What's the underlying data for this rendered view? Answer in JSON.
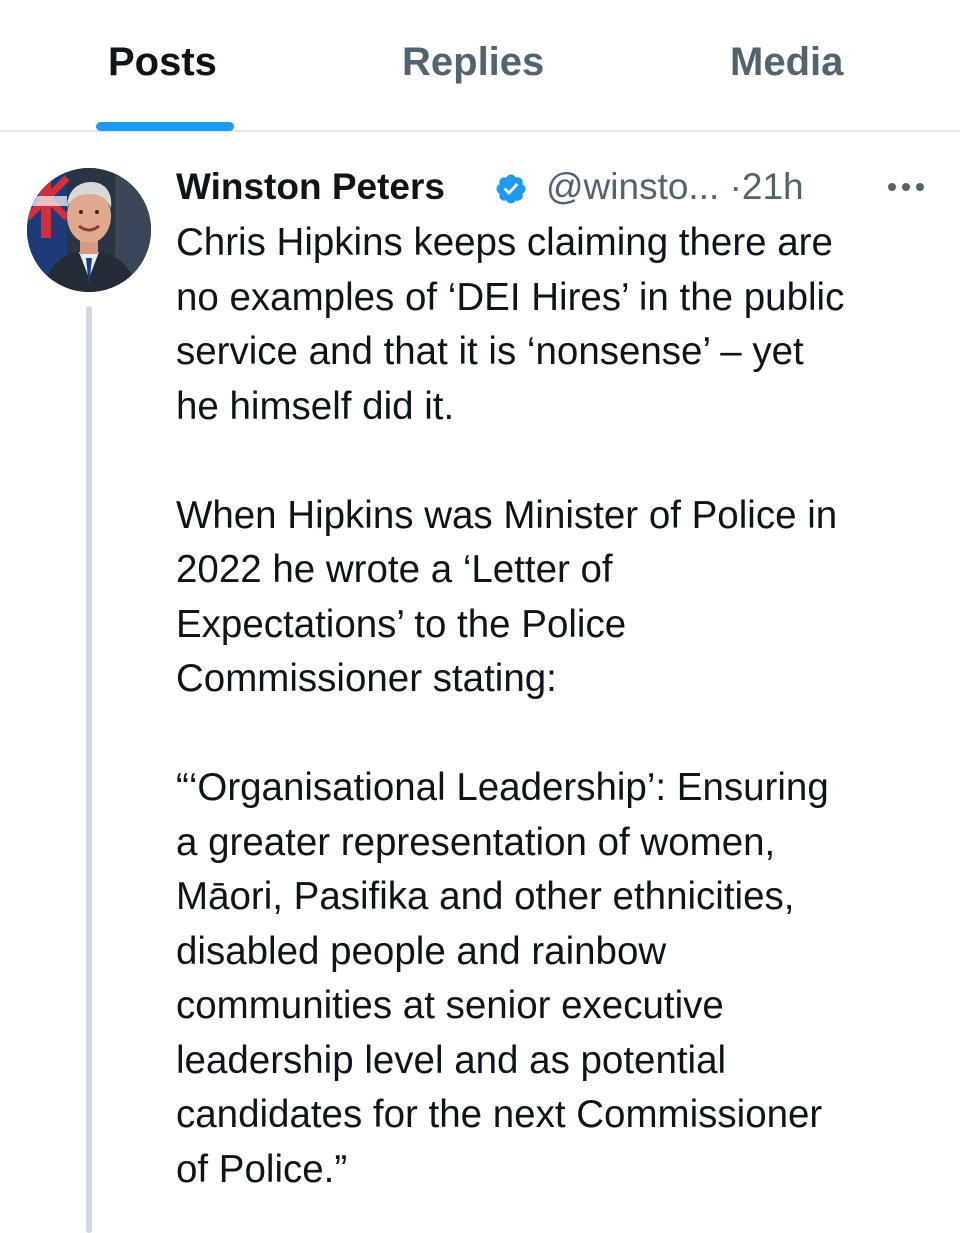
{
  "tabs": [
    {
      "label": "Posts",
      "active": true
    },
    {
      "label": "Replies",
      "active": false
    },
    {
      "label": "Media",
      "active": false
    }
  ],
  "post": {
    "author_name": "Winston Peters",
    "verified": true,
    "handle": "@winsto...",
    "separator": "·",
    "time": "21h",
    "avatar_icon": "profile-photo",
    "more_icon": "ellipsis-icon",
    "paragraphs": [
      "Chris Hipkins keeps claiming there are\nno examples of ‘DEI Hires’ in the public\nservice and that it is ‘nonsense’ – yet\nhe himself did it.",
      "When Hipkins was Minister of Police in\n2022 he wrote a ‘Letter of\nExpectations’ to the Police\nCommissioner stating:",
      "“‘Organisational Leadership’: Ensuring\na greater representation of women,\nMāori, Pasifika and other ethnicities,\ndisabled people and rainbow\ncommunities at senior executive\nleadership level and as potential\ncandidates for the next Commissioner\nof Police.”"
    ]
  },
  "colors": {
    "accent": "#1d9bf0",
    "text_primary": "#0f1419",
    "text_secondary": "#536471",
    "divider": "#e3e8ec",
    "thread_line": "#cfd9de"
  }
}
